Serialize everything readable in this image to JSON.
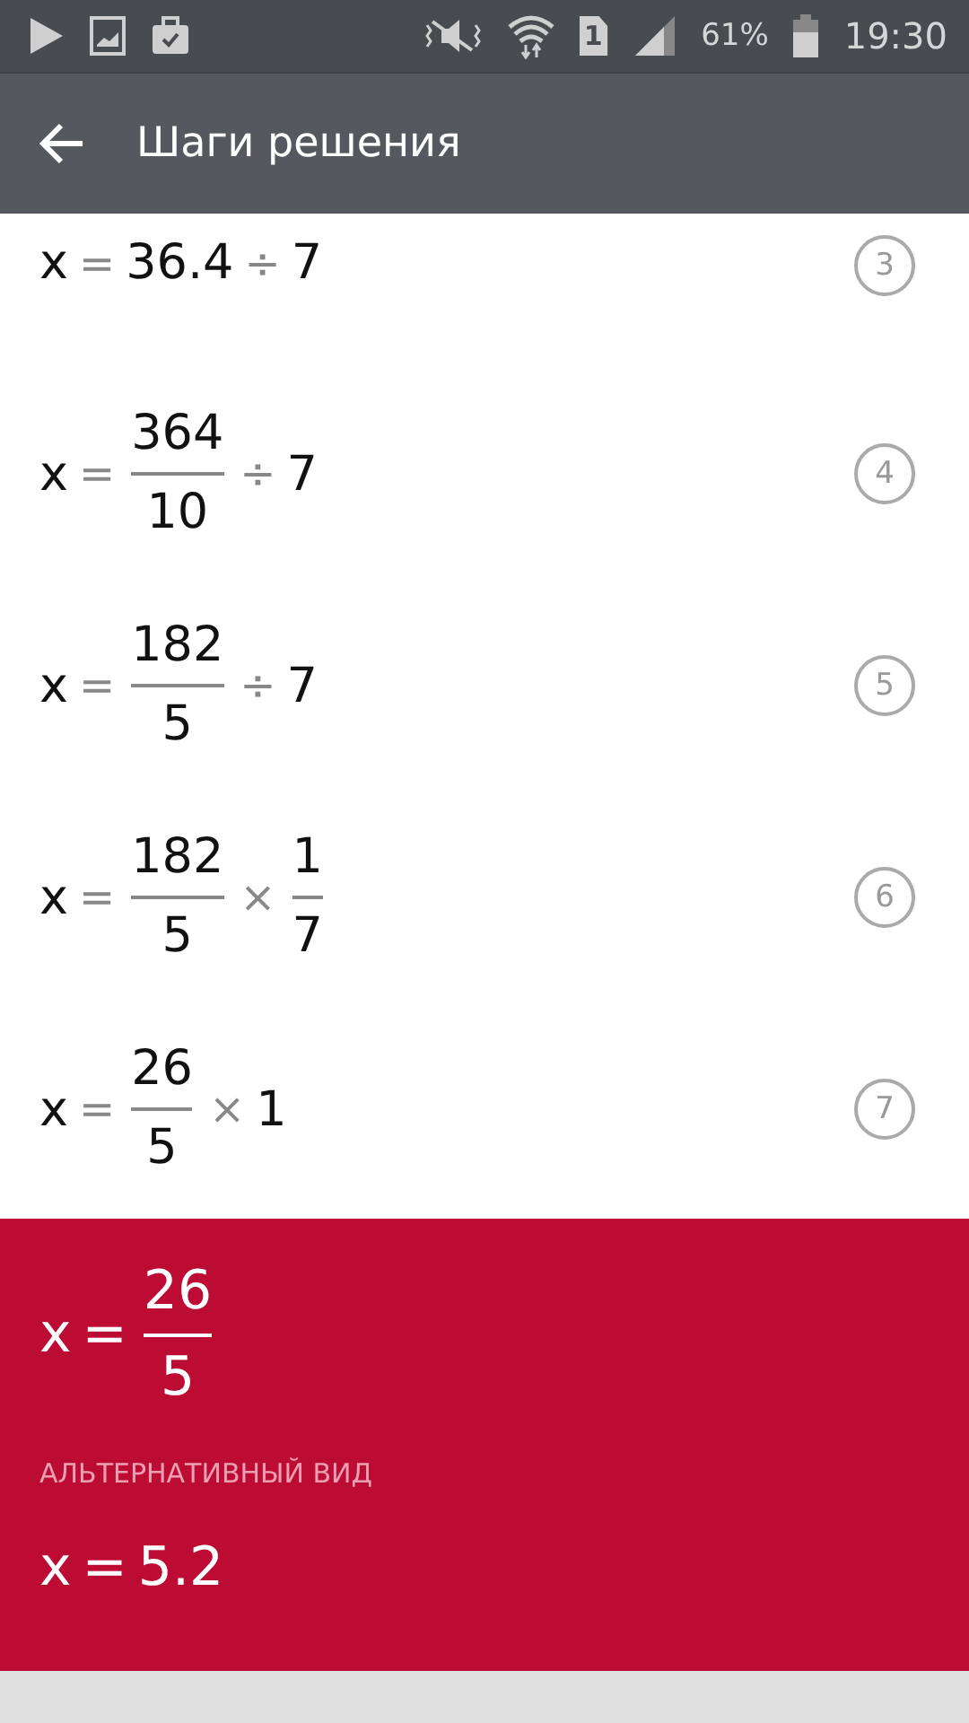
{
  "status_bar": {
    "battery": "61%",
    "time": "19:30",
    "sim": "1"
  },
  "app_bar": {
    "title": "Шаги решения"
  },
  "steps": [
    {
      "number": "3",
      "expr": [
        {
          "kind": "text",
          "text": "x"
        },
        {
          "kind": "op",
          "text": "="
        },
        {
          "kind": "text",
          "text": "36.4"
        },
        {
          "kind": "op",
          "text": "÷"
        },
        {
          "kind": "text",
          "text": "7"
        }
      ]
    },
    {
      "number": "4",
      "expr": [
        {
          "kind": "text",
          "text": "x"
        },
        {
          "kind": "op",
          "text": "="
        },
        {
          "kind": "frac",
          "num": "364",
          "den": "10"
        },
        {
          "kind": "op",
          "text": "÷"
        },
        {
          "kind": "text",
          "text": "7"
        }
      ]
    },
    {
      "number": "5",
      "expr": [
        {
          "kind": "text",
          "text": "x"
        },
        {
          "kind": "op",
          "text": "="
        },
        {
          "kind": "frac",
          "num": "182",
          "den": "5"
        },
        {
          "kind": "op",
          "text": "÷"
        },
        {
          "kind": "text",
          "text": "7"
        }
      ]
    },
    {
      "number": "6",
      "expr": [
        {
          "kind": "text",
          "text": "x"
        },
        {
          "kind": "op",
          "text": "="
        },
        {
          "kind": "frac",
          "num": "182",
          "den": "5"
        },
        {
          "kind": "op",
          "text": "×"
        },
        {
          "kind": "frac",
          "num": "1",
          "den": "7"
        }
      ]
    },
    {
      "number": "7",
      "expr": [
        {
          "kind": "text",
          "text": "x"
        },
        {
          "kind": "op",
          "text": "="
        },
        {
          "kind": "frac",
          "num": "26",
          "den": "5"
        },
        {
          "kind": "op",
          "text": "×"
        },
        {
          "kind": "text",
          "text": "1"
        }
      ]
    }
  ],
  "result": {
    "expr": [
      {
        "kind": "text",
        "text": "x"
      },
      {
        "kind": "op",
        "text": "="
      },
      {
        "kind": "frac",
        "num": "26",
        "den": "5"
      }
    ],
    "alt_label": "АЛЬТЕРНАТИВНЫЙ ВИД",
    "alt_expr": [
      {
        "kind": "text",
        "text": "x"
      },
      {
        "kind": "op",
        "text": "="
      },
      {
        "kind": "text",
        "text": "5.2"
      }
    ]
  }
}
